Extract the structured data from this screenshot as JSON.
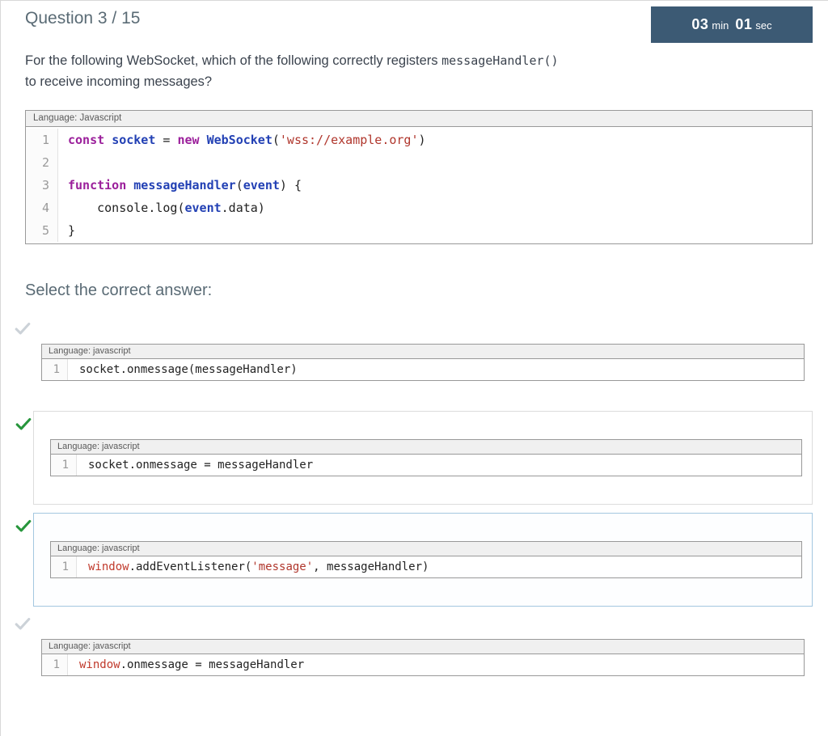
{
  "page": {
    "title": "Question 3 / 15",
    "timer": {
      "minutes": "03",
      "minutes_unit": "min",
      "seconds": "01",
      "seconds_unit": "sec"
    },
    "question_prefix": "For the following WebSocket, which of the following correctly registers ",
    "question_code": "messageHandler()",
    "question_suffix": "to receive incoming messages?",
    "select_prompt": "Select the correct answer:"
  },
  "main_code": {
    "language_label": "Language: Javascript",
    "lines": [
      {
        "n": "1",
        "tokens": [
          [
            "k",
            "const"
          ],
          [
            "p",
            " "
          ],
          [
            "n",
            "socket"
          ],
          [
            "p",
            " = "
          ],
          [
            "k",
            "new"
          ],
          [
            "p",
            " "
          ],
          [
            "n",
            "WebSocket"
          ],
          [
            "p",
            "("
          ],
          [
            "s",
            "'wss://example.org'"
          ],
          [
            "p",
            ")"
          ]
        ]
      },
      {
        "n": "2",
        "tokens": []
      },
      {
        "n": "3",
        "tokens": [
          [
            "k",
            "function"
          ],
          [
            "p",
            " "
          ],
          [
            "n",
            "messageHandler"
          ],
          [
            "p",
            "("
          ],
          [
            "n",
            "event"
          ],
          [
            "p",
            ") {"
          ]
        ]
      },
      {
        "n": "4",
        "tokens": [
          [
            "p",
            "    console.log("
          ],
          [
            "n",
            "event"
          ],
          [
            "p",
            ".data)"
          ]
        ]
      },
      {
        "n": "5",
        "tokens": [
          [
            "p",
            "}"
          ]
        ]
      }
    ]
  },
  "options": [
    {
      "language_label": "Language: javascript",
      "line_number": "1",
      "check": "inactive",
      "boxed": false,
      "highlight": false,
      "tokens": [
        [
          "p",
          "socket.onmessage(messageHandler)"
        ]
      ]
    },
    {
      "language_label": "Language: javascript",
      "line_number": "1",
      "check": "active",
      "boxed": true,
      "highlight": false,
      "tokens": [
        [
          "p",
          "socket.onmessage = messageHandler"
        ]
      ]
    },
    {
      "language_label": "Language: javascript",
      "line_number": "1",
      "check": "active",
      "boxed": true,
      "highlight": true,
      "tokens": [
        [
          "b",
          "window"
        ],
        [
          "p",
          ".addEventListener("
        ],
        [
          "s",
          "'message'"
        ],
        [
          "p",
          ", messageHandler)"
        ]
      ]
    },
    {
      "language_label": "Language: javascript",
      "line_number": "1",
      "check": "inactive",
      "boxed": false,
      "highlight": false,
      "tokens": [
        [
          "b",
          "window"
        ],
        [
          "p",
          ".onmessage = messageHandler"
        ]
      ]
    }
  ]
}
